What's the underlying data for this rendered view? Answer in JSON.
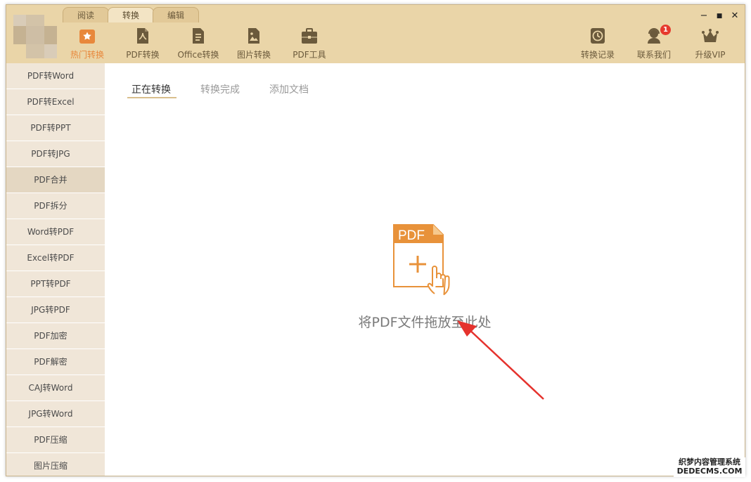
{
  "header": {
    "tabs": [
      "阅读",
      "转换",
      "编辑"
    ],
    "toolbar": [
      {
        "label": "热门转换",
        "icon": "star-icon"
      },
      {
        "label": "PDF转换",
        "icon": "pdf-icon"
      },
      {
        "label": "Office转换",
        "icon": "document-icon"
      },
      {
        "label": "图片转换",
        "icon": "image-icon"
      },
      {
        "label": "PDF工具",
        "icon": "toolbox-icon"
      }
    ],
    "right_tools": [
      {
        "label": "转换记录",
        "icon": "clock-icon"
      },
      {
        "label": "联系我们",
        "icon": "headset-icon",
        "badge": "1"
      },
      {
        "label": "升级VIP",
        "icon": "crown-icon"
      }
    ],
    "window_controls": {
      "minimize": "−",
      "maximize": "■",
      "close": "✕"
    }
  },
  "sidebar": {
    "items": [
      {
        "label": "PDF转Word"
      },
      {
        "label": "PDF转Excel"
      },
      {
        "label": "PDF转PPT"
      },
      {
        "label": "PDF转JPG"
      },
      {
        "label": "PDF合并"
      },
      {
        "label": "PDF拆分"
      },
      {
        "label": "Word转PDF"
      },
      {
        "label": "Excel转PDF"
      },
      {
        "label": "PPT转PDF"
      },
      {
        "label": "JPG转PDF"
      },
      {
        "label": "PDF加密"
      },
      {
        "label": "PDF解密"
      },
      {
        "label": "CAJ转Word"
      },
      {
        "label": "JPG转Word"
      },
      {
        "label": "PDF压缩"
      },
      {
        "label": "图片压缩"
      }
    ],
    "active_index": 4
  },
  "main": {
    "subtabs": [
      "正在转换",
      "转换完成",
      "添加文档"
    ],
    "drop_icon_label": "PDF",
    "drop_text": "将PDF文件拖放至此处"
  },
  "watermark": {
    "line1": "织梦内容管理系统",
    "line2": "DEDECMS.COM"
  },
  "colors": {
    "header_bg": "#ead5a8",
    "accent": "#e8883c",
    "sidebar_bg": "#f0e6d8",
    "arrow": "#e5322d"
  }
}
